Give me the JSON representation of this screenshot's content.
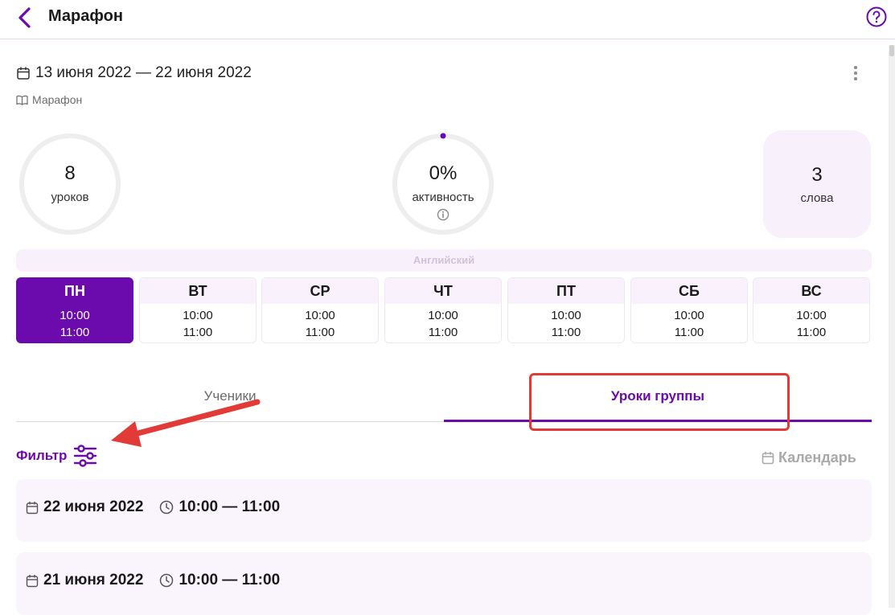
{
  "header": {
    "title": "Марафон",
    "back_icon": "chevron-left-icon",
    "help_icon": "help-circle-icon"
  },
  "course": {
    "date_range": "13 июня 2022 — 22 июня 2022",
    "name": "Марафон"
  },
  "stats": {
    "lessons": {
      "value": "8",
      "label": "уроков"
    },
    "activity": {
      "value": "0%",
      "label": "активность",
      "progress": 0
    },
    "words": {
      "value": "3",
      "label": "слова"
    }
  },
  "language": "Английский",
  "schedule": [
    {
      "day": "ПН",
      "start": "10:00",
      "end": "11:00",
      "active": true
    },
    {
      "day": "ВТ",
      "start": "10:00",
      "end": "11:00",
      "active": false
    },
    {
      "day": "СР",
      "start": "10:00",
      "end": "11:00",
      "active": false
    },
    {
      "day": "ЧТ",
      "start": "10:00",
      "end": "11:00",
      "active": false
    },
    {
      "day": "ПТ",
      "start": "10:00",
      "end": "11:00",
      "active": false
    },
    {
      "day": "СБ",
      "start": "10:00",
      "end": "11:00",
      "active": false
    },
    {
      "day": "ВС",
      "start": "10:00",
      "end": "11:00",
      "active": false
    }
  ],
  "tabs": [
    {
      "label": "Ученики",
      "selected": false
    },
    {
      "label": "Уроки группы",
      "selected": true
    }
  ],
  "toolbar": {
    "filter_label": "Фильтр",
    "calendar_label": "Календарь"
  },
  "lessons": [
    {
      "date": "22 июня 2022",
      "time": "10:00 — 11:00"
    },
    {
      "date": "21 июня 2022",
      "time": "10:00 — 11:00"
    }
  ],
  "colors": {
    "accent": "#6b0aad",
    "surface": "#f8f0fb",
    "annotation": "#e23a36"
  }
}
